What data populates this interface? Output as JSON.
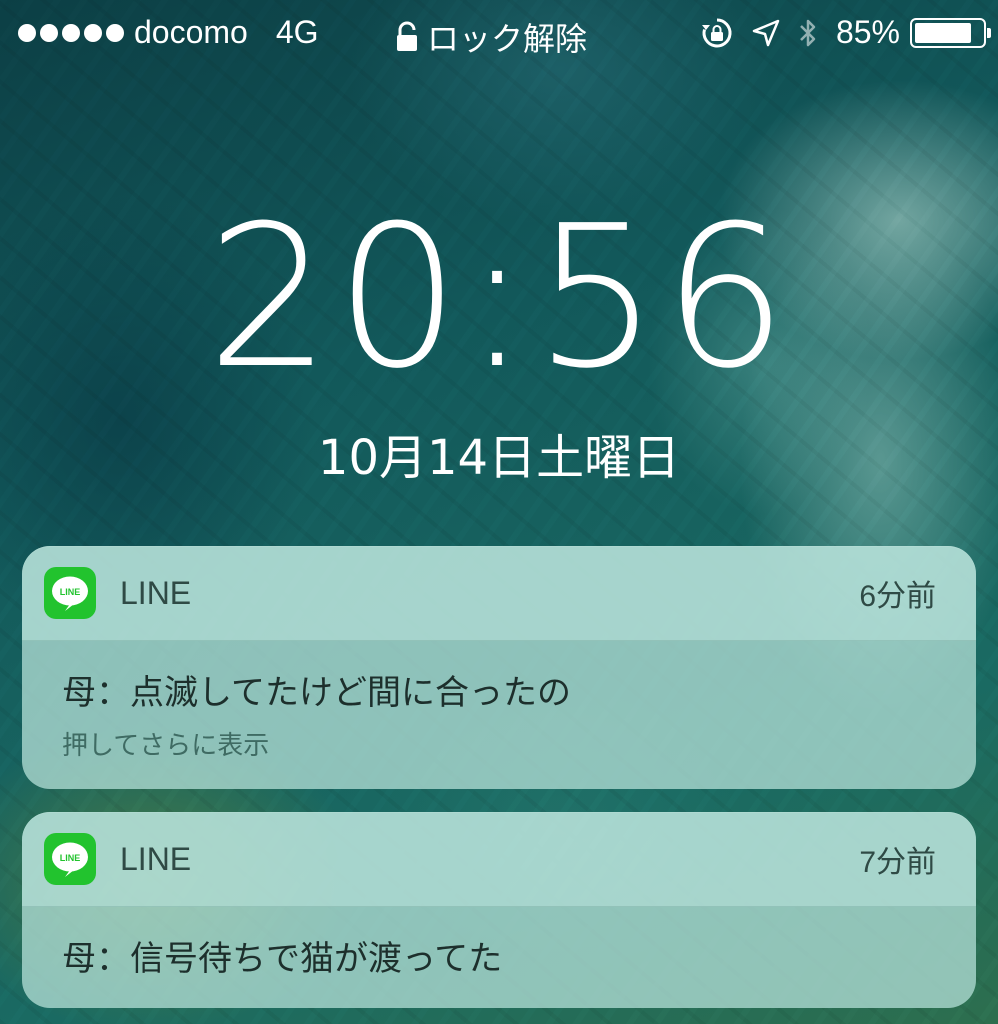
{
  "status_bar": {
    "signal_dots": 5,
    "carrier": "docomo",
    "network": "4G",
    "lock_status": "ロック解除",
    "battery_percent": "85%",
    "battery_level": 0.85,
    "icons": [
      "rotation-lock-icon",
      "location-arrow-icon",
      "bluetooth-icon",
      "battery-icon"
    ]
  },
  "lock_screen": {
    "time": "20:56",
    "date": "10月14日土曜日"
  },
  "notifications": [
    {
      "app_name": "LINE",
      "app_icon_text": "LINE",
      "time_ago": "6分前",
      "message": "母：点滅してたけど間に合ったの",
      "hint": "押してさらに表示"
    },
    {
      "app_name": "LINE",
      "app_icon_text": "LINE",
      "time_ago": "7分前",
      "message": "母：信号待ちで猫が渡ってた"
    }
  ],
  "colors": {
    "line_green": "#22c32e",
    "notification_bg": "#afdcd4",
    "wallpaper_teal": "#17625f"
  }
}
